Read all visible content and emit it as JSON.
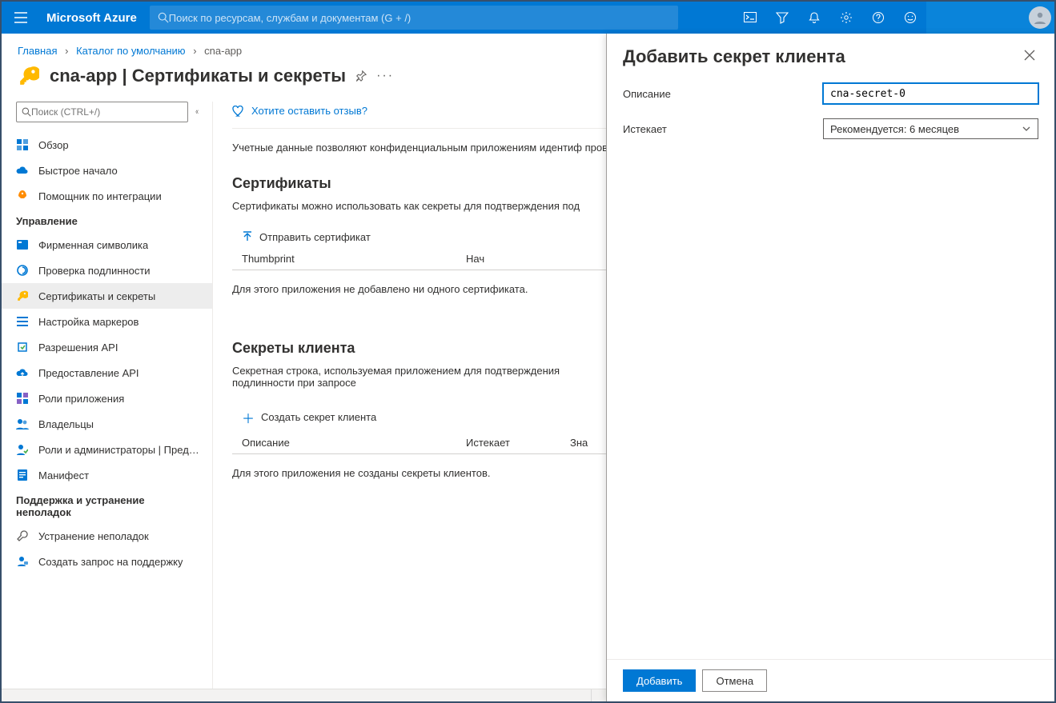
{
  "topbar": {
    "brand": "Microsoft Azure",
    "search_placeholder": "Поиск по ресурсам, службам и документам (G + /)"
  },
  "breadcrumb": {
    "items": [
      "Главная",
      "Каталог по умолчанию",
      "cna-app"
    ]
  },
  "page": {
    "title": "cna-app | Сертификаты и секреты"
  },
  "sidebar": {
    "search_placeholder": "Поиск (CTRL+/)",
    "items_top": [
      {
        "label": "Обзор"
      },
      {
        "label": "Быстрое начало"
      },
      {
        "label": "Помощник по интеграции"
      }
    ],
    "section_manage": "Управление",
    "items_manage": [
      {
        "label": "Фирменная символика"
      },
      {
        "label": "Проверка подлинности"
      },
      {
        "label": "Сертификаты и секреты"
      },
      {
        "label": "Настройка маркеров"
      },
      {
        "label": "Разрешения API"
      },
      {
        "label": "Предоставление API"
      },
      {
        "label": "Роли приложения"
      },
      {
        "label": "Владельцы"
      },
      {
        "label": "Роли и администраторы | Предва..."
      },
      {
        "label": "Манифест"
      }
    ],
    "section_support": "Поддержка и устранение неполадок",
    "items_support": [
      {
        "label": "Устранение неполадок"
      },
      {
        "label": "Создать запрос на поддержку"
      }
    ]
  },
  "main": {
    "feedback": "Хотите оставить отзыв?",
    "intro": "Учетные данные позволяют конфиденциальным приложениям идентиф проверки подлинности). Для лучшей защиты рекомендуется использова",
    "certs_heading": "Сертификаты",
    "certs_sub": "Сертификаты можно использовать как секреты для подтверждения под",
    "upload_cert": "Отправить сертификат",
    "certs_col1": "Thumbprint",
    "certs_col2": "Нач",
    "certs_empty": "Для этого приложения не добавлено ни одного сертификата.",
    "secrets_heading": "Секреты клиента",
    "secrets_sub": "Секретная строка, используемая приложением для подтверждения подлинности при запросе",
    "new_secret": "Создать секрет клиента",
    "secrets_col1": "Описание",
    "secrets_col2": "Истекает",
    "secrets_col3": "Зна",
    "secrets_empty": "Для этого приложения не созданы секреты клиентов."
  },
  "panel": {
    "title": "Добавить секрет клиента",
    "label_desc": "Описание",
    "value_desc": "cna-secret-0",
    "label_expires": "Истекает",
    "value_expires": "Рекомендуется: 6 месяцев",
    "btn_add": "Добавить",
    "btn_cancel": "Отмена"
  }
}
